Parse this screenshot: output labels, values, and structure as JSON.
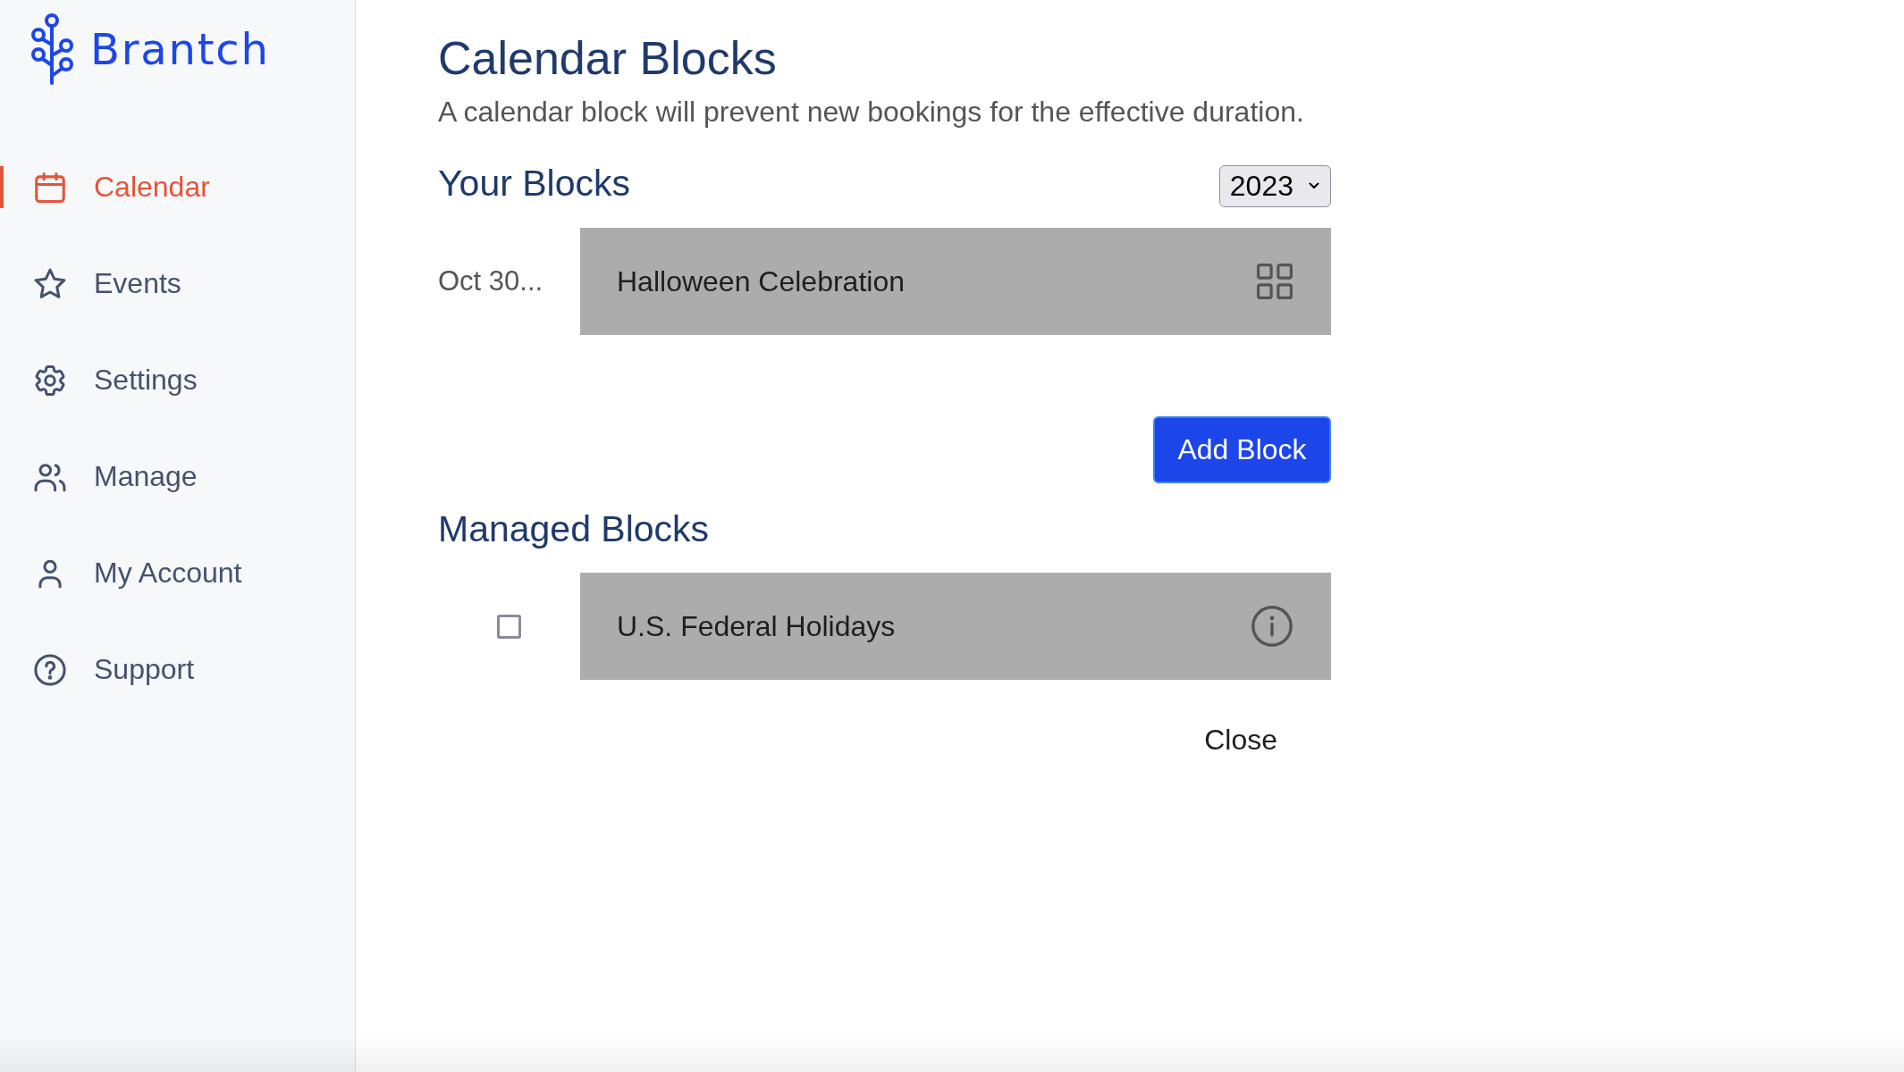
{
  "sidebar": {
    "logo": "Brantch",
    "items": [
      {
        "label": "Calendar",
        "selected": true
      },
      {
        "label": "Events",
        "selected": false
      },
      {
        "label": "Settings",
        "selected": false
      },
      {
        "label": "Manage",
        "selected": false
      },
      {
        "label": "My Account",
        "selected": false
      },
      {
        "label": "Support",
        "selected": false
      }
    ]
  },
  "main": {
    "title": "Calendar Blocks",
    "subtitle": "A calendar block will prevent new bookings for the effective duration.",
    "your_blocks": {
      "heading": "Your Blocks",
      "year_select": {
        "value": "2023"
      },
      "blocks": [
        {
          "date": "Oct 30...",
          "name": "Halloween Celebration"
        }
      ],
      "add_button": "Add Block"
    },
    "managed_blocks": {
      "heading": "Managed Blocks",
      "blocks": [
        {
          "checked": false,
          "name": "U.S. Federal Holidays"
        }
      ]
    },
    "close_button": "Close"
  }
}
